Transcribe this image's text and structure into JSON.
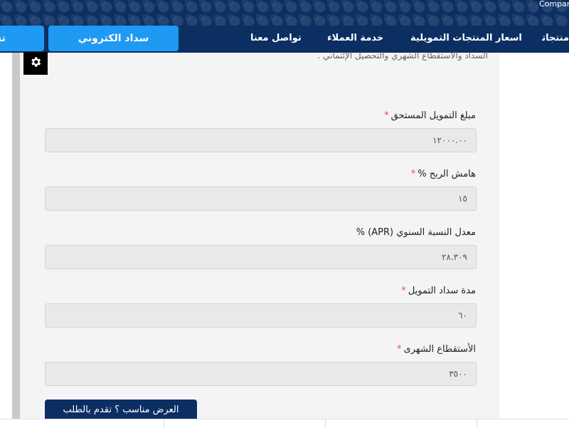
{
  "header": {
    "company_text": "Company",
    "nav": {
      "products": "منتجاتنا",
      "prices": "اسعار المنتجات التمويلية",
      "service": "خدمة العملاء",
      "contact": "تواصل معنا",
      "pay_button": "سداد الكتروني",
      "cut_button": "تسجيل"
    },
    "colors": {
      "navy": "#0c2f63",
      "accent": "#1e9af2"
    }
  },
  "panel": {
    "top_text": "السداد والاستقطاع الشهري والتحصيل الإئتماني ."
  },
  "form": {
    "fields": [
      {
        "label": "مبلغ التمويل المستحق",
        "required": "*",
        "value": "١٢٠٠٠.٠٠"
      },
      {
        "label": "هامش الربح %",
        "required": "*",
        "value": "١٥"
      },
      {
        "label": "معدل النسبة السنوي (APR) %",
        "required": "",
        "value": "٢٨.٣٠٩"
      },
      {
        "label": "مدة سداد التمويل",
        "required": "*",
        "value": "٦٠"
      },
      {
        "label": "الأستقطاع الشهرى",
        "required": "*",
        "value": "٣٥٠٠"
      }
    ],
    "submit_label": "العرض مناسب ؟ تقدم بالطلب"
  },
  "icons": {
    "settings": "gear-icon"
  }
}
